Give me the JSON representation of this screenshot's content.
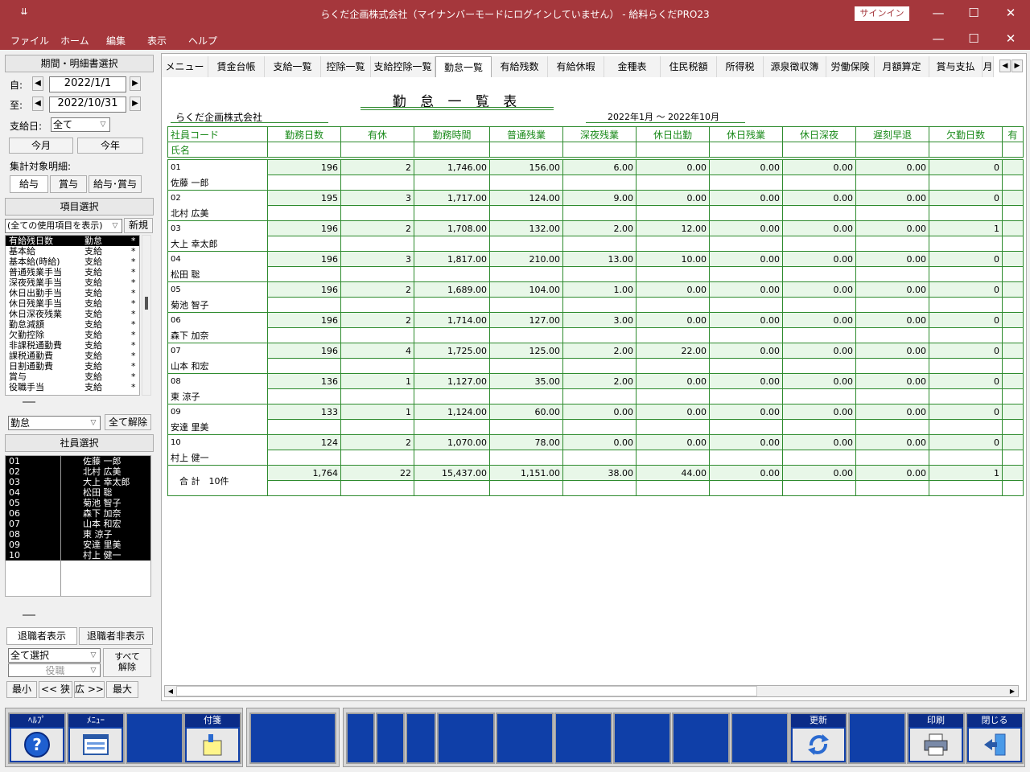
{
  "window": {
    "title": "らくだ企画株式会社（マイナンバーモードにログインしていません） - 給料らくだPRO23",
    "signin": "サインイン",
    "min": "—",
    "max": "☐",
    "close": "✕"
  },
  "menu": [
    "ファイル",
    "ホーム",
    "編集",
    "表示",
    "ヘルプ"
  ],
  "left": {
    "period_header": "期間・明細書選択",
    "from_label": "自:",
    "from_value": "2022/1/1",
    "to_label": "至:",
    "to_value": "2022/10/31",
    "payday_label": "支給日:",
    "payday_value": "全て",
    "this_month": "今月",
    "this_year": "今年",
    "target_label": "集計対象明細:",
    "target_buttons": [
      "給与",
      "賞与",
      "給与･賞与"
    ],
    "item_header": "項目選択",
    "item_filter": "(全ての使用項目を表示)",
    "new_btn": "新規",
    "items": [
      [
        "有給残日数",
        "勤怠",
        "*"
      ],
      [
        "基本給",
        "支給",
        "*"
      ],
      [
        "基本給(時給)",
        "支給",
        "*"
      ],
      [
        "普通残業手当",
        "支給",
        "*"
      ],
      [
        "深夜残業手当",
        "支給",
        "*"
      ],
      [
        "休日出勤手当",
        "支給",
        "*"
      ],
      [
        "休日残業手当",
        "支給",
        "*"
      ],
      [
        "休日深夜残業",
        "支給",
        "*"
      ],
      [
        "勤怠減額",
        "支給",
        "*"
      ],
      [
        "欠勤控除",
        "支給",
        "*"
      ],
      [
        "非課税通勤費",
        "支給",
        "*"
      ],
      [
        "課税通勤費",
        "支給",
        "*"
      ],
      [
        "日割通勤費",
        "支給",
        "*"
      ],
      [
        "賞与",
        "支給",
        "*"
      ],
      [
        "役職手当",
        "支給",
        "*"
      ]
    ],
    "item_category": "勤怠",
    "clear_all": "全て解除",
    "emp_header": "社員選択",
    "employees": [
      [
        "01",
        "佐藤 一郎"
      ],
      [
        "02",
        "北村 広美"
      ],
      [
        "03",
        "大上 幸太郎"
      ],
      [
        "04",
        "松田 聡"
      ],
      [
        "05",
        "菊池 智子"
      ],
      [
        "06",
        "森下 加奈"
      ],
      [
        "07",
        "山本 和宏"
      ],
      [
        "08",
        "東 涼子"
      ],
      [
        "09",
        "安達 里美"
      ],
      [
        "10",
        "村上 健一"
      ]
    ],
    "retired_show": "退職者表示",
    "retired_hide": "退職者非表示",
    "select_all": "全て選択",
    "position": "役職",
    "deselect_all_1": "すべて",
    "deselect_all_2": "解除",
    "zoom": [
      "最小",
      "<< 狭",
      "広 >>",
      "最大"
    ]
  },
  "tabs": [
    "メニュー",
    "賃金台帳",
    "支給一覧",
    "控除一覧",
    "支給控除一覧",
    "勤怠一覧",
    "有給残数",
    "有給休暇",
    "金種表",
    "住民税額",
    "所得税",
    "源泉徴収簿",
    "労働保険",
    "月額算定",
    "賞与支払",
    "月"
  ],
  "report": {
    "title": "勤 怠 一 覧 表",
    "company": "らくだ企画株式会社",
    "period": "2022年1月 ～ 2022年10月",
    "col_code": "社員コード",
    "col_name": "氏名",
    "columns": [
      "勤務日数",
      "有休",
      "勤務時間",
      "普通残業",
      "深夜残業",
      "休日出勤",
      "休日残業",
      "休日深夜",
      "遅刻早退",
      "欠勤日数",
      "有"
    ],
    "rows": [
      {
        "code": "01",
        "name": "佐藤 一郎",
        "vals": [
          "196",
          "2",
          "1,746.00",
          "156.00",
          "6.00",
          "0.00",
          "0.00",
          "0.00",
          "0.00",
          "0",
          ""
        ]
      },
      {
        "code": "02",
        "name": "北村 広美",
        "vals": [
          "195",
          "3",
          "1,717.00",
          "124.00",
          "9.00",
          "0.00",
          "0.00",
          "0.00",
          "0.00",
          "0",
          ""
        ]
      },
      {
        "code": "03",
        "name": "大上 幸太郎",
        "vals": [
          "196",
          "2",
          "1,708.00",
          "132.00",
          "2.00",
          "12.00",
          "0.00",
          "0.00",
          "0.00",
          "1",
          ""
        ]
      },
      {
        "code": "04",
        "name": "松田 聡",
        "vals": [
          "196",
          "3",
          "1,817.00",
          "210.00",
          "13.00",
          "10.00",
          "0.00",
          "0.00",
          "0.00",
          "0",
          ""
        ]
      },
      {
        "code": "05",
        "name": "菊池 智子",
        "vals": [
          "196",
          "2",
          "1,689.00",
          "104.00",
          "1.00",
          "0.00",
          "0.00",
          "0.00",
          "0.00",
          "0",
          ""
        ]
      },
      {
        "code": "06",
        "name": "森下 加奈",
        "vals": [
          "196",
          "2",
          "1,714.00",
          "127.00",
          "3.00",
          "0.00",
          "0.00",
          "0.00",
          "0.00",
          "0",
          ""
        ]
      },
      {
        "code": "07",
        "name": "山本 和宏",
        "vals": [
          "196",
          "4",
          "1,725.00",
          "125.00",
          "2.00",
          "22.00",
          "0.00",
          "0.00",
          "0.00",
          "0",
          ""
        ]
      },
      {
        "code": "08",
        "name": "東 涼子",
        "vals": [
          "136",
          "1",
          "1,127.00",
          "35.00",
          "2.00",
          "0.00",
          "0.00",
          "0.00",
          "0.00",
          "0",
          ""
        ]
      },
      {
        "code": "09",
        "name": "安達 里美",
        "vals": [
          "133",
          "1",
          "1,124.00",
          "60.00",
          "0.00",
          "0.00",
          "0.00",
          "0.00",
          "0.00",
          "0",
          ""
        ]
      },
      {
        "code": "10",
        "name": "村上 健一",
        "vals": [
          "124",
          "2",
          "1,070.00",
          "78.00",
          "0.00",
          "0.00",
          "0.00",
          "0.00",
          "0.00",
          "0",
          ""
        ]
      }
    ],
    "total_label": "合 計　10件",
    "total_vals": [
      "1,764",
      "22",
      "15,437.00",
      "1,151.00",
      "38.00",
      "44.00",
      "0.00",
      "0.00",
      "0.00",
      "1",
      ""
    ]
  },
  "fkeys": {
    "help": "ﾍﾙﾌﾟ",
    "menu": "ﾒﾆｭｰ",
    "note": "付箋",
    "update": "更新",
    "print": "印刷",
    "close": "閉じる"
  }
}
